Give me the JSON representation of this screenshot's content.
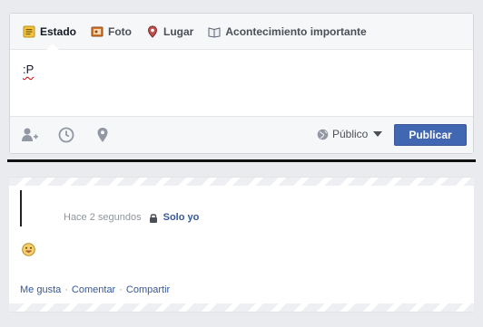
{
  "composer": {
    "tabs": [
      {
        "label": "Estado",
        "icon": "status-icon"
      },
      {
        "label": "Foto",
        "icon": "photo-icon"
      },
      {
        "label": "Lugar",
        "icon": "place-icon"
      },
      {
        "label": "Acontecimiento importante",
        "icon": "life-event-icon"
      }
    ],
    "text": ":P",
    "footer_icons": [
      "tag-friends-icon",
      "clock-icon",
      "location-icon"
    ],
    "privacy_label": "Público",
    "publish_label": "Publicar"
  },
  "post": {
    "time": "Hace 2 segundos",
    "audience": "Solo yo",
    "emoji": "tongue-emoji-icon",
    "actions": [
      "Me gusta",
      "Comentar",
      "Compartir"
    ]
  },
  "colors": {
    "accent": "#4267b2",
    "link": "#365899",
    "page_bg": "#e9ebee"
  }
}
